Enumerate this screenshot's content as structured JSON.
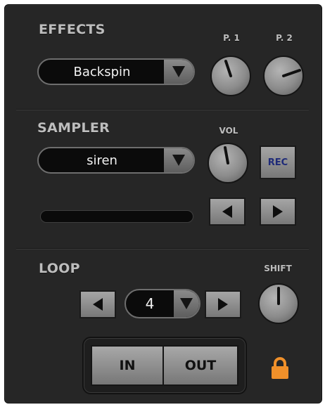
{
  "effects": {
    "title": "EFFECTS",
    "selected": "Backspin",
    "p1_label": "P. 1",
    "p2_label": "P. 2"
  },
  "sampler": {
    "title": "SAMPLER",
    "selected": "siren",
    "vol_label": "VOL",
    "rec_label": "REC",
    "progress": 0
  },
  "loop": {
    "title": "LOOP",
    "value": "4",
    "shift_label": "SHIFT",
    "in_label": "IN",
    "out_label": "OUT"
  },
  "icons": {
    "dropdown_arrow": "triangle-down",
    "prev": "triangle-left",
    "next": "triangle-right",
    "lock": "padlock"
  },
  "colors": {
    "panel": "#262626",
    "label": "#bdbdbd",
    "rec_text": "#1e2a78",
    "lock": "#f0902a"
  }
}
